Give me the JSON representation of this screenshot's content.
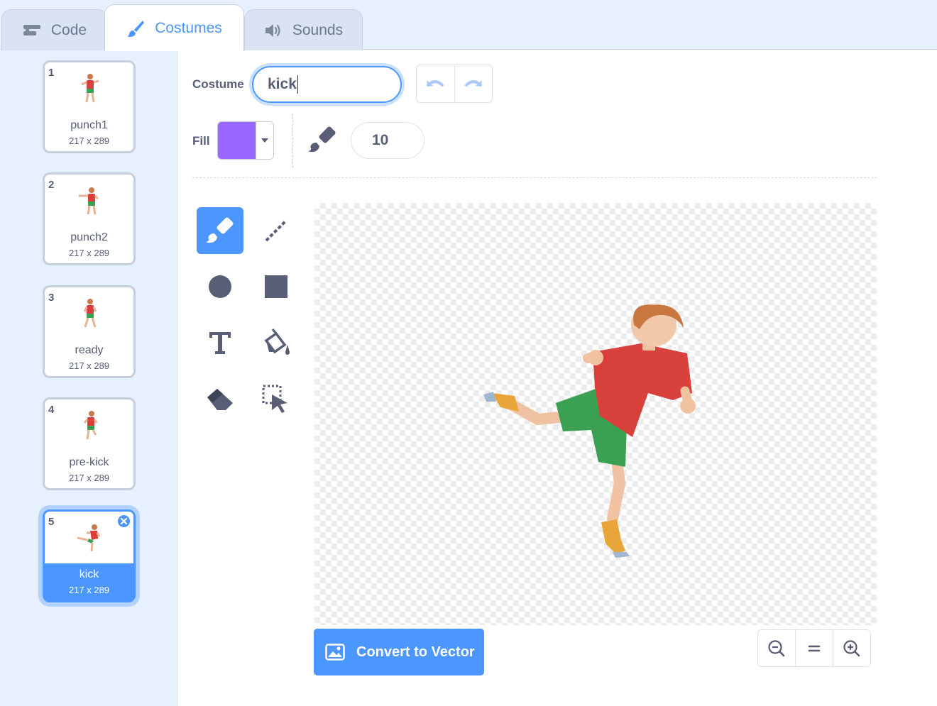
{
  "tabs": [
    {
      "label": "Code",
      "icon": "code-blocks-icon"
    },
    {
      "label": "Costumes",
      "icon": "paintbrush-icon",
      "active": true
    },
    {
      "label": "Sounds",
      "icon": "speaker-icon"
    }
  ],
  "costumes": [
    {
      "number": "1",
      "name": "punch1",
      "size": "217 x 289"
    },
    {
      "number": "2",
      "name": "punch2",
      "size": "217 x 289"
    },
    {
      "number": "3",
      "name": "ready",
      "size": "217 x 289"
    },
    {
      "number": "4",
      "name": "pre-kick",
      "size": "217 x 289"
    },
    {
      "number": "5",
      "name": "kick",
      "size": "217 x 289",
      "selected": true
    }
  ],
  "toolbar": {
    "costume_label": "Costume",
    "costume_name": "kick",
    "fill_label": "Fill",
    "fill_color": "#9966ff",
    "brush_size": "10"
  },
  "tools": [
    "brush-icon",
    "line-icon",
    "circle-icon",
    "rectangle-icon",
    "text-icon",
    "fill-bucket-icon",
    "eraser-icon",
    "select-icon"
  ],
  "actions": {
    "convert_label": "Convert to Vector"
  },
  "colors": {
    "accent": "#4c97ff",
    "text": "#575e75",
    "sidebar_bg": "#e6f0ff"
  }
}
